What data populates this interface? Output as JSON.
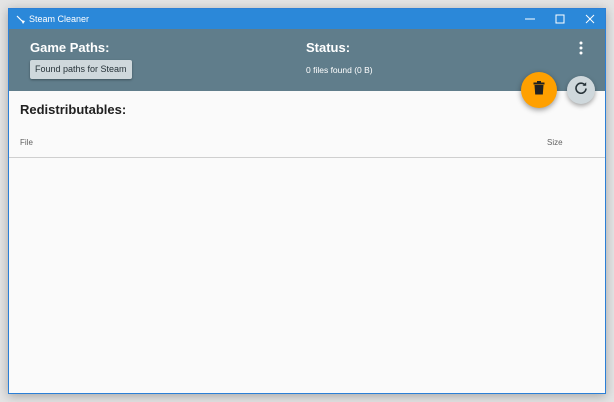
{
  "window": {
    "title": "Steam Cleaner",
    "controls": {
      "minimize": "minimize-icon",
      "maximize": "maximize-icon",
      "close": "close-icon"
    }
  },
  "header": {
    "game_paths_label": "Game Paths:",
    "paths_button_label": "Found paths for Steam",
    "status_label": "Status:",
    "status_text": "0 files found (0 B)",
    "menu_icon": "more-vertical-icon"
  },
  "actions": {
    "delete_icon": "trash-icon",
    "refresh_icon": "refresh-icon"
  },
  "redistributables": {
    "title": "Redistributables:",
    "columns": [
      "File",
      "Size"
    ],
    "rows": []
  },
  "colors": {
    "titlebar": "#2b88d9",
    "header": "#607d8b",
    "delete_fab": "#ffa000",
    "secondary_button": "#cfd8dc",
    "background": "#fafafa"
  }
}
